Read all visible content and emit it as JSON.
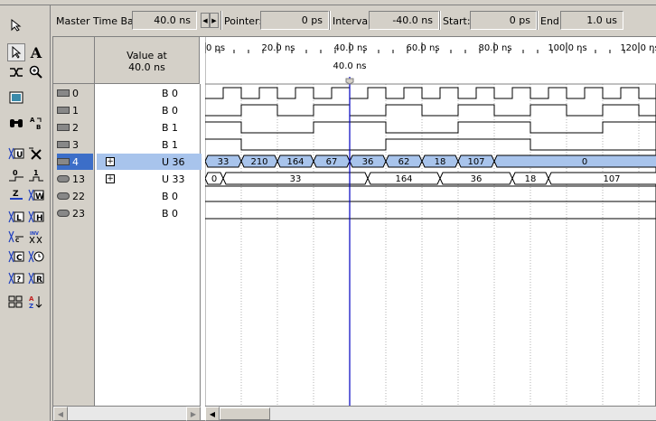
{
  "header": {
    "master_time_bar_label": "Master Time Bar:",
    "master_time_bar_value": "40.0 ns",
    "pointer_label": "Pointer:",
    "pointer_value": "0 ps",
    "interval_label": "Interval:",
    "interval_value": "-40.0 ns",
    "start_label": "Start:",
    "start_value": "0 ps",
    "end_label": "End:",
    "end_value": "1.0 us"
  },
  "columns": {
    "value_at_line1": "Value at",
    "value_at_line2": "40.0 ns"
  },
  "timeline": {
    "ticks": [
      "0 ps",
      "20.0 ns",
      "40.0 ns",
      "60.0 ns",
      "80.0 ns",
      "100.0 ns",
      "120.0 ns"
    ],
    "cursor_label": "40.0 ns"
  },
  "toolbar_icons": [
    "pointer-icon",
    "text-tool-icon",
    "node-finder-icon",
    "zoom-icon",
    "full-screen-icon",
    "find-icon",
    "replace-icon",
    "uninitialized-icon",
    "forcing-unknown-icon",
    "forcing-low-icon",
    "forcing-high-icon",
    "high-impedance-icon",
    "weak-unknown-icon",
    "weak-low-icon",
    "weak-high-icon",
    "invert-icon",
    "count-value-icon",
    "clock-icon",
    "arbitrary-value-icon",
    "random-value-icon",
    "snap-grid-icon",
    "sort-icon"
  ],
  "signals": [
    {
      "name": "0",
      "value": "B 0",
      "type": "input",
      "expandable": false
    },
    {
      "name": "1",
      "value": "B 0",
      "type": "input",
      "expandable": false
    },
    {
      "name": "2",
      "value": "B 1",
      "type": "input",
      "expandable": false
    },
    {
      "name": "3",
      "value": "B 1",
      "type": "input",
      "expandable": false
    },
    {
      "name": "4",
      "value": "U 36",
      "type": "input",
      "expandable": true,
      "selected": true
    },
    {
      "name": "13",
      "value": "U 33",
      "type": "output",
      "expandable": true
    },
    {
      "name": "22",
      "value": "B 0",
      "type": "output",
      "expandable": false
    },
    {
      "name": "23",
      "value": "B 0",
      "type": "output",
      "expandable": false
    }
  ],
  "bus_values": {
    "sig4": [
      "33",
      "210",
      "164",
      "67",
      "36",
      "62",
      "18",
      "107",
      "0"
    ],
    "sig13": [
      "0",
      "33",
      "164",
      "36",
      "18",
      "107"
    ]
  },
  "colors": {
    "selected_row": "#3c6ec8",
    "bus_fill": "#a8c4ec",
    "cursor_line": "#0000c0"
  }
}
